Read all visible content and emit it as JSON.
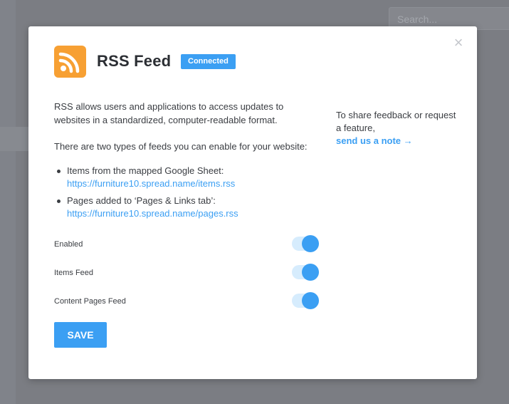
{
  "background": {
    "search": {
      "placeholder": "Search..."
    }
  },
  "modal": {
    "title": "RSS Feed",
    "badge": "Connected",
    "close_glyph": "×",
    "logo_icon": "rss-icon",
    "description": "RSS allows users and applications to access updates to websites in a standardized, computer-readable format.",
    "types_intro": "There are two types of feeds you can enable for your website:",
    "feeds": [
      {
        "label": "Items from the mapped Google Sheet:",
        "url": "https://furniture10.spread.name/items.rss"
      },
      {
        "label": "Pages added to ‘Pages & Links tab’:",
        "url": "https://furniture10.spread.name/pages.rss"
      }
    ],
    "feedback": {
      "text": "To share feedback or request a feature,",
      "link": "send us a note →"
    },
    "toggles": [
      {
        "label": "Enabled",
        "on": true
      },
      {
        "label": "Items Feed",
        "on": true
      },
      {
        "label": "Content Pages Feed",
        "on": true
      }
    ],
    "save_label": "SAVE"
  },
  "colors": {
    "accent": "#3b9ff3",
    "rss_orange": "#f7a033",
    "overlay": "#7b7d83"
  }
}
